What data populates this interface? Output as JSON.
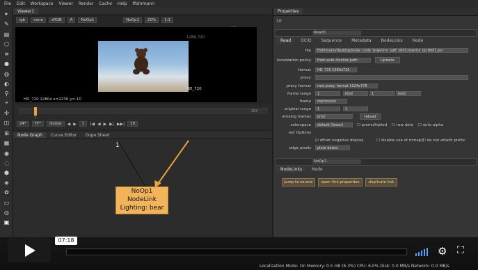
{
  "menu": [
    "File",
    "Edit",
    "Workspace",
    "Viewer",
    "Render",
    "Cache",
    "Help",
    "tfohrmann"
  ],
  "viewer": {
    "tab": "Viewer1",
    "channels": "rgb",
    "alpha": "none",
    "colorspace": "sRGB",
    "input_a": "A",
    "input_a_node": "NoOp1",
    "input_b_node": "NoOp1",
    "proxy": "2D",
    "zoom": "20%",
    "ratio": "1:1",
    "format_top": "1280.720",
    "format_label": "HD_720",
    "info_line": "HD_720 1280x  x=2230 y=-10",
    "timeline_start": "1",
    "timeline_end": "204",
    "frame": "1",
    "fps": "24*",
    "tf": "TF*",
    "global": "Global",
    "skip": "10"
  },
  "nodegraph": {
    "tabs": [
      "Node Graph",
      "Curve Editor",
      "Dope Sheet"
    ],
    "input_number": "1",
    "node_lines": [
      "NoOp1",
      "NodeLink",
      "Lighting: bear"
    ]
  },
  "properties": {
    "title": "Properties",
    "count": "10",
    "read_node": "Read5",
    "read_tabs": [
      "Read",
      "OCIO",
      "Sequence",
      "Metadata",
      "NodeLinks",
      "Node"
    ],
    "fields": [
      {
        "label": "file",
        "value": "ffohrmann/Desktop/nuke_node_linker/mr_soft_v003.mantra_ipr.0001.exr"
      },
      {
        "label": "localization policy",
        "value": "from auto-localize path"
      },
      {
        "label": "format",
        "value": "HD_720 1280x720"
      },
      {
        "label": "proxy",
        "value": ""
      },
      {
        "label": "proxy format",
        "value": "root.proxy_format 1024x778"
      },
      {
        "label": "frame range",
        "value": "1"
      },
      {
        "label": "frame",
        "value": "expression"
      },
      {
        "label": "original range",
        "value": "1"
      },
      {
        "label": "missing frames",
        "value": "error"
      },
      {
        "label": "colorspace",
        "value": "default (linear)"
      },
      {
        "label": "exr Options",
        "value": ""
      },
      {
        "label": "edge pixels",
        "value": "plate detect"
      }
    ],
    "frame_range_mode_1": "hold",
    "frame_range_end": "1",
    "frame_range_mode_2": "hold",
    "original_range_end": "1",
    "update_label": "Update",
    "reload_label": "reload",
    "premultiplied": "premultiplied",
    "raw_data": "raw data",
    "auto_alpha": "auto alpha",
    "offset_negative": "offset negative display",
    "disable_mmap": "disable use of mmap()",
    "no_attach_prefix": "do not attach prefix",
    "noop_node": "NoOp1",
    "noop_tabs": [
      "NodeLinks",
      "Node"
    ],
    "buttons": [
      "jump to source",
      "open link properties",
      "duplicate link"
    ]
  },
  "player": {
    "time": "07:18"
  },
  "status": "Localization Mode: On  Memory: 0.5 GB (6.3%)  CPU: 6.0%  Disk: 0.0 MB/s  Network: 0.0 MB/s"
}
